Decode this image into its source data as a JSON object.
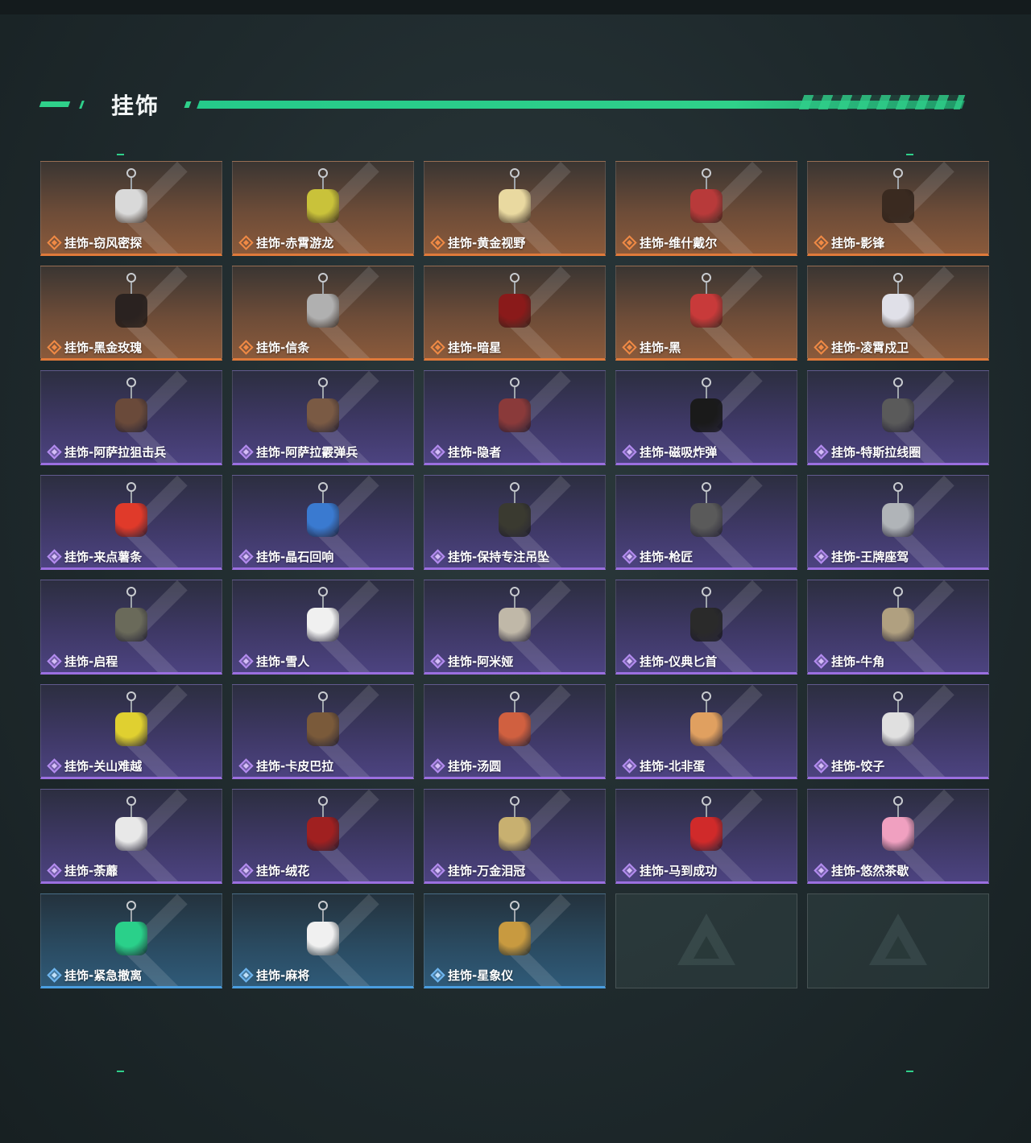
{
  "section_title": "挂饰",
  "colors": {
    "accent": "#2fd08a",
    "orange": "#e07a3a",
    "purple": "#9b6fe0",
    "blue": "#4a9ee0"
  },
  "items": [
    {
      "label": "挂饰-窃风密探",
      "rarity": "orange",
      "charm": "#d9d9d9"
    },
    {
      "label": "挂饰-赤霄游龙",
      "rarity": "orange",
      "charm": "#c9c23a"
    },
    {
      "label": "挂饰-黄金视野",
      "rarity": "orange",
      "charm": "#e9d9a0"
    },
    {
      "label": "挂饰-维什戴尔",
      "rarity": "orange",
      "charm": "#b83a3a"
    },
    {
      "label": "挂饰-影锋",
      "rarity": "orange",
      "charm": "#3a2a20"
    },
    {
      "label": "挂饰-黑金玫瑰",
      "rarity": "orange",
      "charm": "#2a2220"
    },
    {
      "label": "挂饰-信条",
      "rarity": "orange",
      "charm": "#b0b0b0"
    },
    {
      "label": "挂饰-暗星",
      "rarity": "orange",
      "charm": "#8a1a1a"
    },
    {
      "label": "挂饰-黑",
      "rarity": "orange",
      "charm": "#c83a3a"
    },
    {
      "label": "挂饰-凌霄戍卫",
      "rarity": "orange",
      "charm": "#e0e0e8"
    },
    {
      "label": "挂饰-阿萨拉狙击兵",
      "rarity": "purple",
      "charm": "#6a4a3a"
    },
    {
      "label": "挂饰-阿萨拉霰弹兵",
      "rarity": "purple",
      "charm": "#7a5a44"
    },
    {
      "label": "挂饰-隐者",
      "rarity": "purple",
      "charm": "#8a3a3a"
    },
    {
      "label": "挂饰-磁吸炸弹",
      "rarity": "purple",
      "charm": "#1a1a1a"
    },
    {
      "label": "挂饰-特斯拉线圈",
      "rarity": "purple",
      "charm": "#5a5a5a"
    },
    {
      "label": "挂饰-来点薯条",
      "rarity": "purple",
      "charm": "#e03a2a"
    },
    {
      "label": "挂饰-晶石回响",
      "rarity": "purple",
      "charm": "#3a7ad0"
    },
    {
      "label": "挂饰-保持专注吊坠",
      "rarity": "purple",
      "charm": "#3a3a30"
    },
    {
      "label": "挂饰-枪匠",
      "rarity": "purple",
      "charm": "#5a5a5a"
    },
    {
      "label": "挂饰-王牌座驾",
      "rarity": "purple",
      "charm": "#b0b4b8"
    },
    {
      "label": "挂饰-启程",
      "rarity": "purple",
      "charm": "#6a6a5a"
    },
    {
      "label": "挂饰-雪人",
      "rarity": "purple",
      "charm": "#f0f0f0"
    },
    {
      "label": "挂饰-阿米娅",
      "rarity": "purple",
      "charm": "#c0b8a8"
    },
    {
      "label": "挂饰-仪典匕首",
      "rarity": "purple",
      "charm": "#2a2a2a"
    },
    {
      "label": "挂饰-牛角",
      "rarity": "purple",
      "charm": "#b0a080"
    },
    {
      "label": "挂饰-关山难越",
      "rarity": "purple",
      "charm": "#e0d030"
    },
    {
      "label": "挂饰-卡皮巴拉",
      "rarity": "purple",
      "charm": "#7a5a3a"
    },
    {
      "label": "挂饰-汤圆",
      "rarity": "purple",
      "charm": "#d06040"
    },
    {
      "label": "挂饰-北非蛋",
      "rarity": "purple",
      "charm": "#e0a060"
    },
    {
      "label": "挂饰-饺子",
      "rarity": "purple",
      "charm": "#e0e0e0"
    },
    {
      "label": "挂饰-荼蘼",
      "rarity": "purple",
      "charm": "#e8e8e8"
    },
    {
      "label": "挂饰-绒花",
      "rarity": "purple",
      "charm": "#a02020"
    },
    {
      "label": "挂饰-万金泪冠",
      "rarity": "purple",
      "charm": "#c8b070"
    },
    {
      "label": "挂饰-马到成功",
      "rarity": "purple",
      "charm": "#d02a2a"
    },
    {
      "label": "挂饰-悠然茶歇",
      "rarity": "purple",
      "charm": "#f0a0c0"
    },
    {
      "label": "挂饰-紧急撤离",
      "rarity": "blue",
      "charm": "#2ad08a"
    },
    {
      "label": "挂饰-麻将",
      "rarity": "blue",
      "charm": "#f0f0f0"
    },
    {
      "label": "挂饰-星象仪",
      "rarity": "blue",
      "charm": "#c89a40"
    },
    {
      "label": "",
      "rarity": "empty",
      "charm": ""
    },
    {
      "label": "",
      "rarity": "empty",
      "charm": ""
    }
  ]
}
